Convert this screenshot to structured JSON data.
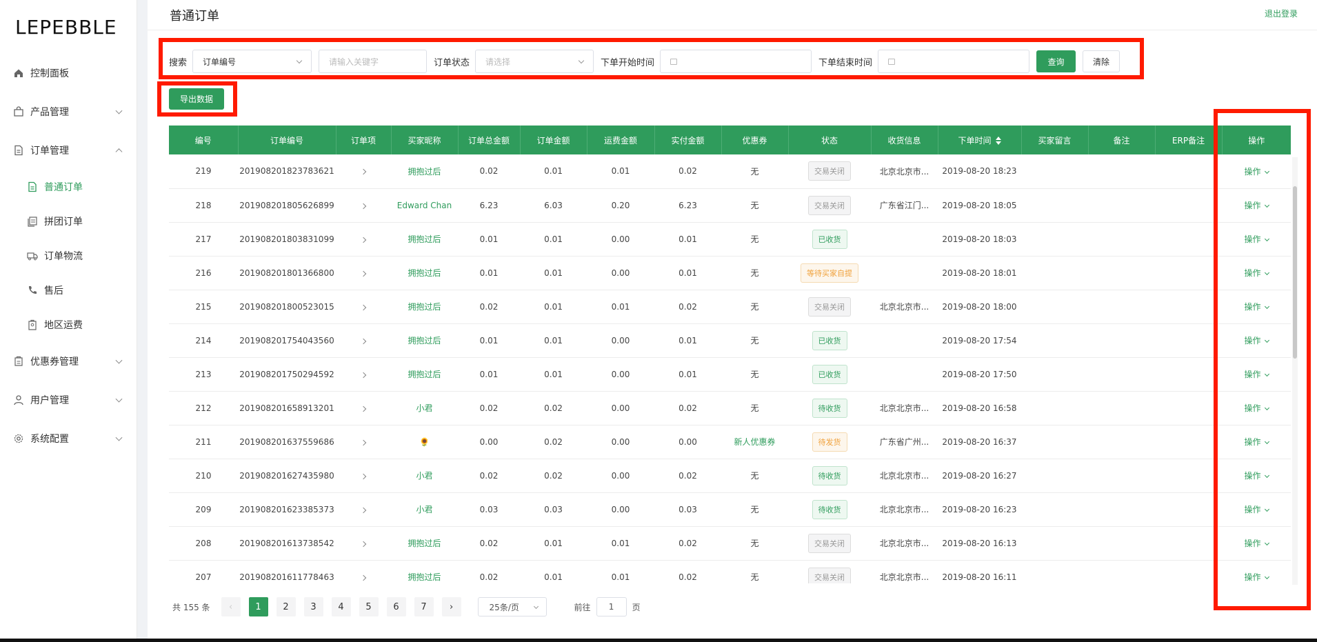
{
  "brand": "LEPEBBLE",
  "colors": {
    "accent": "#2f9c5c",
    "highlight": "#ff1a00"
  },
  "sidebar": {
    "items": [
      {
        "label": "控制面板",
        "icon": "home-icon"
      },
      {
        "label": "产品管理",
        "icon": "bag-icon",
        "expandable": true
      },
      {
        "label": "订单管理",
        "icon": "document-icon",
        "expanded": true
      }
    ],
    "sub_items": [
      {
        "label": "普通订单",
        "icon": "order-icon",
        "active": true
      },
      {
        "label": "拼团订单",
        "icon": "group-order-icon"
      },
      {
        "label": "订单物流",
        "icon": "truck-icon"
      },
      {
        "label": "售后",
        "icon": "phone-icon"
      },
      {
        "label": "地区运费",
        "icon": "shipping-fee-icon"
      }
    ],
    "bottom_items": [
      {
        "label": "优惠券管理",
        "icon": "coupon-icon"
      },
      {
        "label": "用户管理",
        "icon": "user-icon"
      },
      {
        "label": "系统配置",
        "icon": "gear-icon"
      }
    ]
  },
  "header": {
    "title": "普通订单",
    "logout": "退出登录"
  },
  "filter": {
    "search_label": "搜索",
    "search_type": "订单编号",
    "keyword_placeholder": "请输入关键字",
    "status_label": "订单状态",
    "status_placeholder": "请选择",
    "start_label": "下单开始时间",
    "end_label": "下单结束时间",
    "query_button": "查询",
    "clear_button": "清除"
  },
  "export_button": "导出数据",
  "table": {
    "columns": [
      "编号",
      "订单编号",
      "订单项",
      "买家昵称",
      "订单总金额",
      "订单金额",
      "运费金额",
      "实付金额",
      "优惠券",
      "状态",
      "收货信息",
      "下单时间",
      "买家留言",
      "备注",
      "ERP备注",
      "操作"
    ],
    "op_label": "操作",
    "rows": [
      {
        "id": "219",
        "order_no": "201908201823783621",
        "buyer": "拥抱过后",
        "total": "0.02",
        "amount": "0.01",
        "freight": "0.01",
        "paid": "0.02",
        "coupon": "无",
        "status": "交易关闭",
        "status_type": "closed",
        "address": "北京北京市...",
        "time": "2019-08-20 18:23"
      },
      {
        "id": "218",
        "order_no": "201908201805626899",
        "buyer": "Edward Chan",
        "total": "6.23",
        "amount": "6.03",
        "freight": "0.20",
        "paid": "6.23",
        "coupon": "无",
        "status": "交易关闭",
        "status_type": "closed",
        "address": "广东省江门...",
        "time": "2019-08-20 18:05"
      },
      {
        "id": "217",
        "order_no": "201908201803831099",
        "buyer": "拥抱过后",
        "total": "0.01",
        "amount": "0.01",
        "freight": "0.00",
        "paid": "0.01",
        "coupon": "无",
        "status": "已收货",
        "status_type": "green",
        "address": "",
        "time": "2019-08-20 18:03"
      },
      {
        "id": "216",
        "order_no": "201908201801366800",
        "buyer": "拥抱过后",
        "total": "0.01",
        "amount": "0.01",
        "freight": "0.00",
        "paid": "0.01",
        "coupon": "无",
        "status": "等待买家自提",
        "status_type": "orange",
        "address": "",
        "time": "2019-08-20 18:01"
      },
      {
        "id": "215",
        "order_no": "201908201800523015",
        "buyer": "拥抱过后",
        "total": "0.02",
        "amount": "0.01",
        "freight": "0.01",
        "paid": "0.02",
        "coupon": "无",
        "status": "交易关闭",
        "status_type": "closed",
        "address": "北京北京市...",
        "time": "2019-08-20 18:00"
      },
      {
        "id": "214",
        "order_no": "201908201754043560",
        "buyer": "拥抱过后",
        "total": "0.01",
        "amount": "0.01",
        "freight": "0.00",
        "paid": "0.01",
        "coupon": "无",
        "status": "已收货",
        "status_type": "green",
        "address": "",
        "time": "2019-08-20 17:54"
      },
      {
        "id": "213",
        "order_no": "201908201750294592",
        "buyer": "拥抱过后",
        "total": "0.01",
        "amount": "0.01",
        "freight": "0.00",
        "paid": "0.01",
        "coupon": "无",
        "status": "已收货",
        "status_type": "green",
        "address": "",
        "time": "2019-08-20 17:50"
      },
      {
        "id": "212",
        "order_no": "201908201658913201",
        "buyer": "小君",
        "total": "0.02",
        "amount": "0.02",
        "freight": "0.00",
        "paid": "0.02",
        "coupon": "无",
        "status": "待收货",
        "status_type": "green",
        "address": "北京北京市...",
        "time": "2019-08-20 16:58"
      },
      {
        "id": "211",
        "order_no": "201908201637559686",
        "buyer": "🌻",
        "total": "0.00",
        "amount": "0.02",
        "freight": "0.00",
        "paid": "0.00",
        "coupon": "新人优惠券",
        "status": "待发货",
        "status_type": "orange",
        "address": "广东省广州...",
        "time": "2019-08-20 16:37"
      },
      {
        "id": "210",
        "order_no": "201908201627435980",
        "buyer": "小君",
        "total": "0.02",
        "amount": "0.02",
        "freight": "0.00",
        "paid": "0.02",
        "coupon": "无",
        "status": "待收货",
        "status_type": "green",
        "address": "北京北京市...",
        "time": "2019-08-20 16:27"
      },
      {
        "id": "209",
        "order_no": "201908201623385373",
        "buyer": "小君",
        "total": "0.03",
        "amount": "0.03",
        "freight": "0.00",
        "paid": "0.03",
        "coupon": "无",
        "status": "待收货",
        "status_type": "green",
        "address": "北京北京市...",
        "time": "2019-08-20 16:23"
      },
      {
        "id": "208",
        "order_no": "201908201613738542",
        "buyer": "拥抱过后",
        "total": "0.02",
        "amount": "0.01",
        "freight": "0.01",
        "paid": "0.02",
        "coupon": "无",
        "status": "交易关闭",
        "status_type": "closed",
        "address": "北京北京市...",
        "time": "2019-08-20 16:13"
      },
      {
        "id": "207",
        "order_no": "201908201611778463",
        "buyer": "拥抱过后",
        "total": "0.02",
        "amount": "0.01",
        "freight": "0.01",
        "paid": "0.02",
        "coupon": "无",
        "status": "交易关闭",
        "status_type": "closed",
        "address": "北京北京市...",
        "time": "2019-08-20 16:11"
      }
    ]
  },
  "pagination": {
    "total": "共 155 条",
    "pages": [
      "1",
      "2",
      "3",
      "4",
      "5",
      "6",
      "7"
    ],
    "current": "1",
    "page_size": "25条/页",
    "goto_label": "前往",
    "goto_value": "1",
    "page_suffix": "页"
  }
}
